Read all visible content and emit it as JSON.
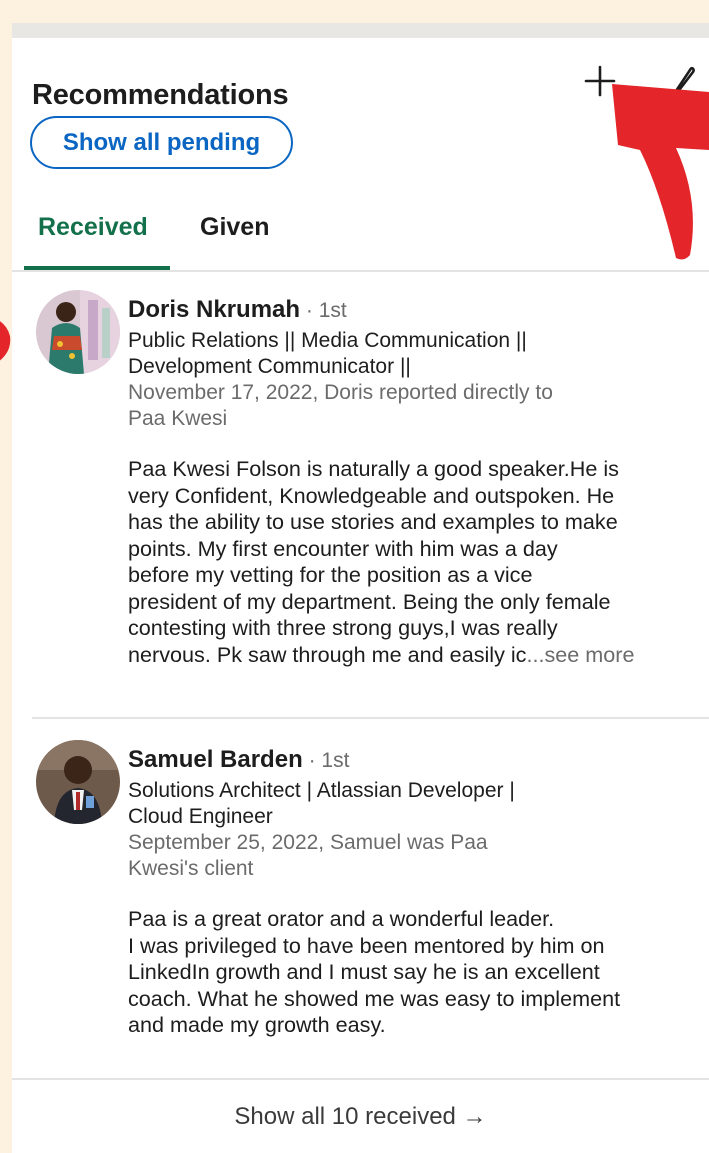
{
  "section": {
    "title": "Recommendations",
    "show_pending_label": "Show all pending"
  },
  "tabs": [
    {
      "label": "Received",
      "active": true
    },
    {
      "label": "Given",
      "active": false
    }
  ],
  "recommendations": [
    {
      "name": "Doris Nkrumah",
      "degree": " · 1st",
      "headline_1": "Public Relations || Media Communication ||",
      "headline_2": "Development Communicator ||",
      "meta_1": "November 17, 2022, Doris reported directly to",
      "meta_2": "Paa Kwesi",
      "body_lines": [
        "Paa Kwesi Folson is naturally a good speaker.He is",
        "very Confident, Knowledgeable and outspoken. He",
        "has the ability to use stories and examples to make",
        "points. My first encounter with him was a day",
        "before my vetting for the position as a vice",
        "president of my department. Being the only female",
        "contesting with three strong guys,I  was really"
      ],
      "body_last": "nervous. Pk saw through me and easily ic",
      "see_more": "...see more"
    },
    {
      "name": "Samuel Barden",
      "degree": " · 1st",
      "headline_1": "Solutions Architect | Atlassian Developer |",
      "headline_2": "Cloud Engineer",
      "meta_1": "September 25, 2022, Samuel was Paa",
      "meta_2": "Kwesi's client",
      "body_lines": [
        "Paa is a great orator and a wonderful leader.",
        "I was privileged to have been mentored by him on",
        "LinkedIn growth and I must say he is an excellent",
        "coach. What he showed me was easy to implement",
        "and made my growth easy."
      ]
    }
  ],
  "footer": {
    "show_all_label": "Show all 10 received →"
  },
  "colors": {
    "background": "#fdf1df",
    "accent_blue": "#0a66c2",
    "active_tab_green": "#12704a",
    "annotation_red": "#e4262a"
  },
  "icons": {
    "add": "plus-icon",
    "edit": "pencil-icon",
    "annotation": "arrow-annotation"
  }
}
